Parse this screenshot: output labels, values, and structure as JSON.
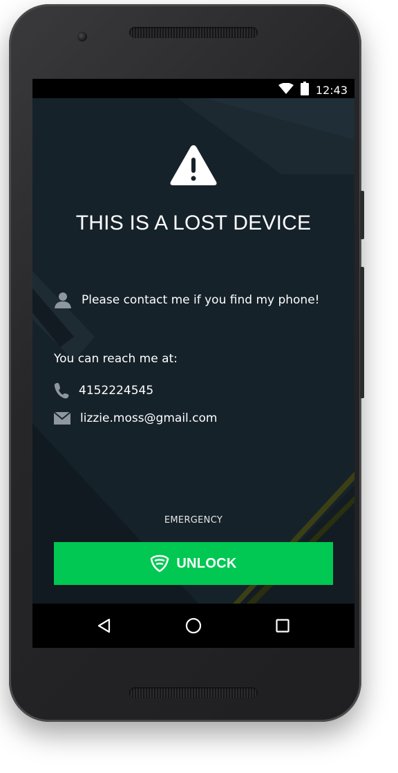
{
  "status_bar": {
    "time": "12:43",
    "icons": [
      "wifi-icon",
      "battery-icon"
    ]
  },
  "lock_screen": {
    "title": "THIS IS A LOST DEVICE",
    "message": "Please contact me if you find my phone!",
    "reach_label": "You can reach me at:",
    "phone": "4152224545",
    "email": "lizzie.moss@gmail.com",
    "emergency_label": "EMERGENCY",
    "unlock_label": "UNLOCK"
  },
  "nav_bar": {
    "buttons": [
      "back-icon",
      "home-icon",
      "recents-icon"
    ]
  },
  "colors": {
    "accent": "#00c853",
    "screen_bg": "#16222a"
  }
}
